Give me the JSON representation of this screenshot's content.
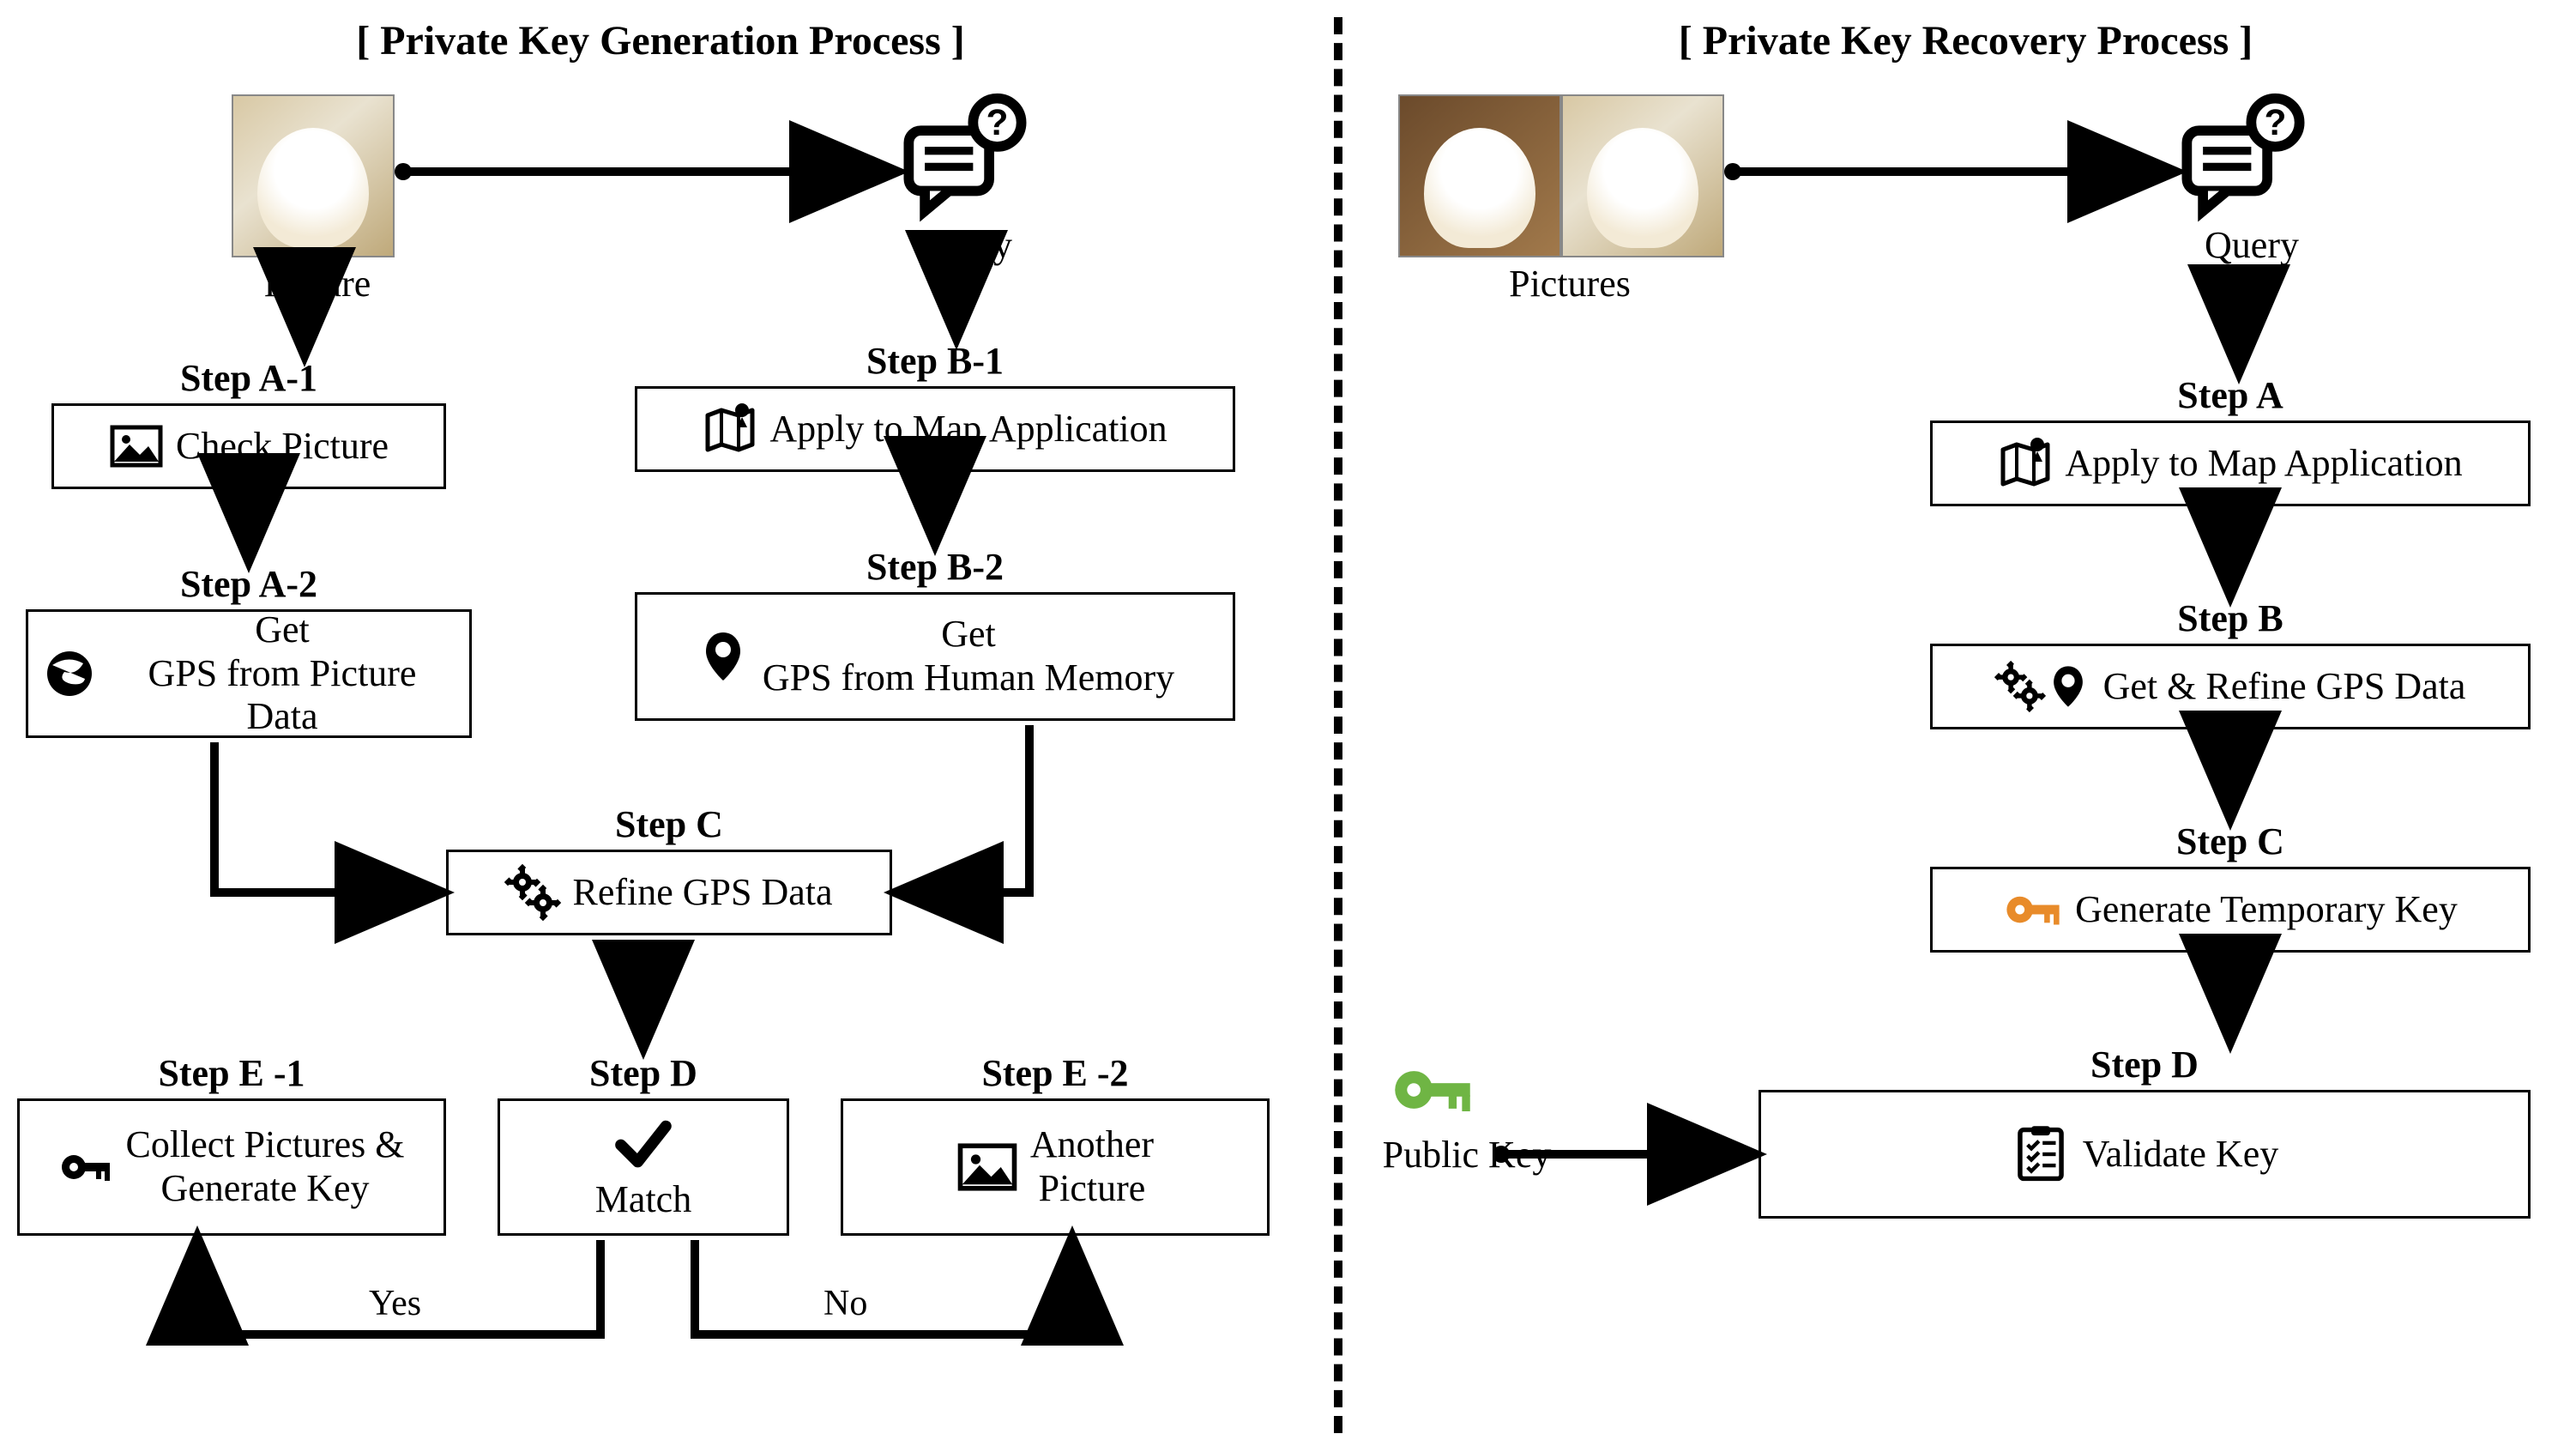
{
  "left": {
    "title": "[ Private Key Generation Process ]",
    "picture_label": "Picture",
    "query_label": "Query",
    "stepA1": {
      "title": "Step A-1",
      "text": "Check Picture"
    },
    "stepA2": {
      "title": "Step A-2",
      "text": "Get\nGPS from Picture Data"
    },
    "stepB1": {
      "title": "Step B-1",
      "text": "Apply to Map Application"
    },
    "stepB2": {
      "title": "Step B-2",
      "text": "Get\nGPS from Human Memory"
    },
    "stepC": {
      "title": "Step C",
      "text": "Refine GPS Data"
    },
    "stepD": {
      "title": "Step D",
      "text": "Match"
    },
    "stepE1": {
      "title": "Step E -1",
      "text": "Collect Pictures &\nGenerate Key"
    },
    "stepE2": {
      "title": "Step E -2",
      "text": "Another\nPicture"
    },
    "yes": "Yes",
    "no": "No"
  },
  "right": {
    "title": "[ Private Key Recovery Process ]",
    "pictures_label": "Pictures",
    "query_label": "Query",
    "public_key_label": "Public Key",
    "stepA": {
      "title": "Step A",
      "text": "Apply to Map Application"
    },
    "stepB": {
      "title": "Step B",
      "text": "Get & Refine GPS Data"
    },
    "stepC": {
      "title": "Step C",
      "text": "Generate Temporary Key"
    },
    "stepD": {
      "title": "Step D",
      "text": "Validate Key"
    }
  },
  "icons": {
    "picture": "picture-icon",
    "globe": "globe-icon",
    "map": "map-icon",
    "pin": "pin-icon",
    "gears": "gears-icon",
    "check": "check-icon",
    "key_black": "key-icon",
    "key_orange": "key-orange-icon",
    "key_green": "key-green-icon",
    "checklist": "checklist-icon",
    "query": "query-icon"
  }
}
